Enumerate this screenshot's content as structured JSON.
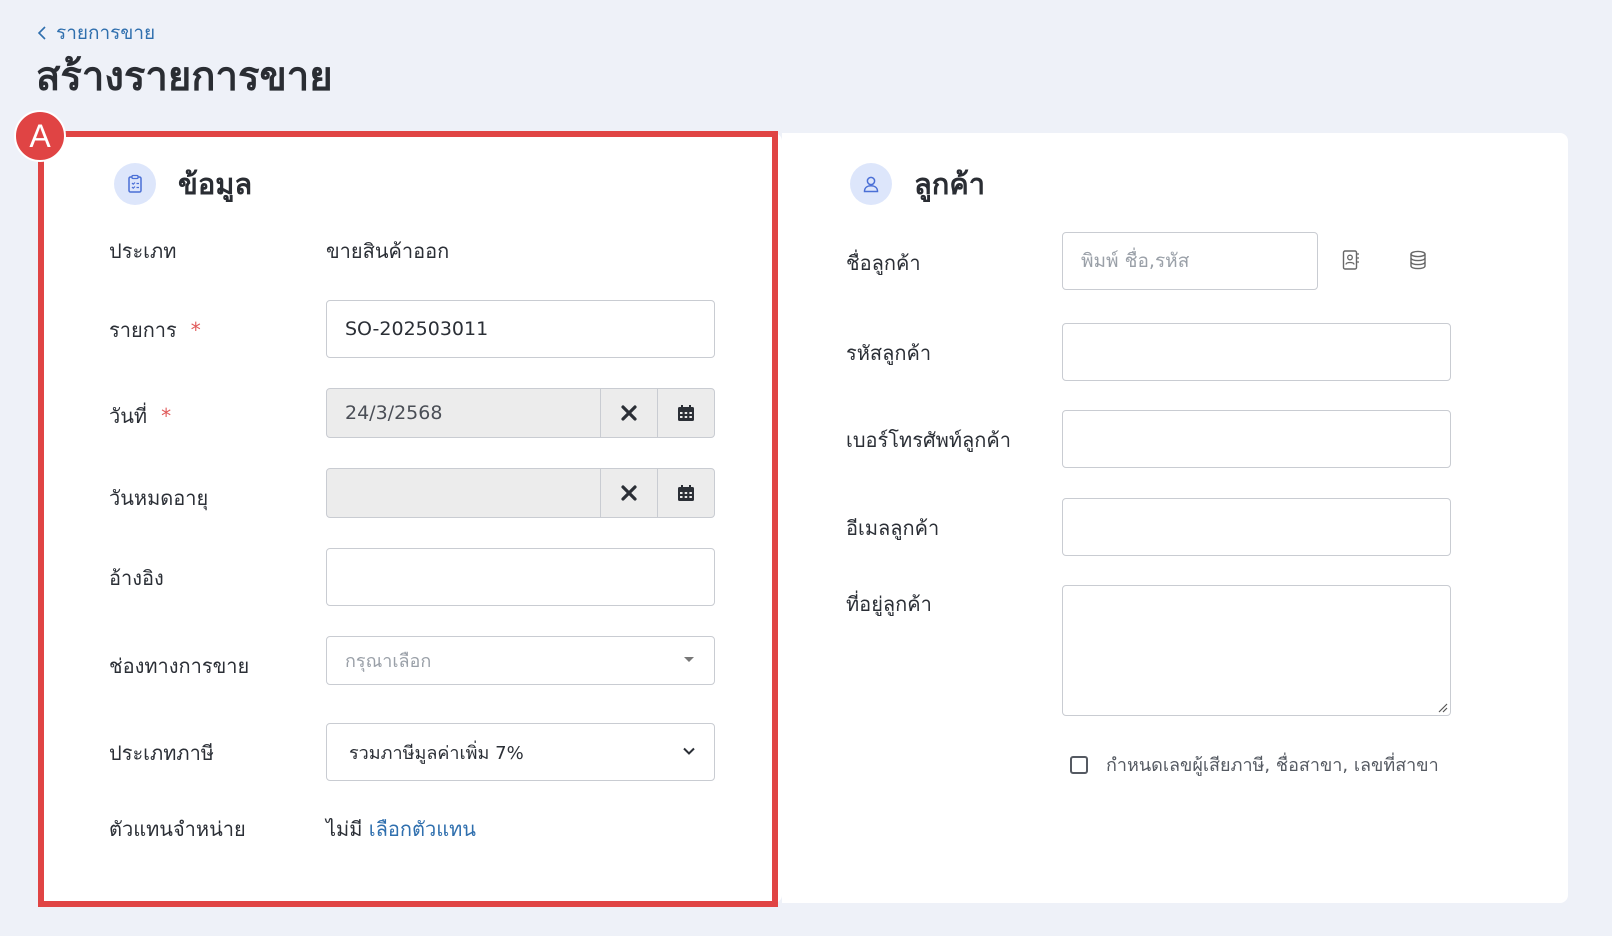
{
  "breadcrumb": {
    "back_label": "รายการขาย"
  },
  "page": {
    "title": "สร้างรายการขาย"
  },
  "annotation": {
    "marker": "A",
    "color": "#e04444"
  },
  "info": {
    "title": "ข้อมูล",
    "type_label": "ประเภท",
    "type_value": "ขายสินค้าออก",
    "doc_label": "รายการ",
    "doc_value": "SO-202503011",
    "date_label": "วันที่",
    "date_value": "24/3/2568",
    "expire_label": "วันหมดอายุ",
    "expire_value": "",
    "ref_label": "อ้างอิง",
    "ref_value": "",
    "channel_label": "ช่องทางการขาย",
    "channel_placeholder": "กรุณาเลือก",
    "tax_label": "ประเภทภาษี",
    "tax_value": "รวมภาษีมูลค่าเพิ่ม 7%",
    "agent_label": "ตัวแทนจำหน่าย",
    "agent_value": "ไม่มี",
    "agent_link": "เลือกตัวแทน",
    "required_mark": "*"
  },
  "customer": {
    "title": "ลูกค้า",
    "name_label": "ชื่อลูกค้า",
    "name_placeholder": "พิมพ์ ชื่อ,รหัส",
    "code_label": "รหัสลูกค้า",
    "phone_label": "เบอร์โทรศัพท์ลูกค้า",
    "email_label": "อีเมลลูกค้า",
    "address_label": "ที่อยู่ลูกค้า",
    "tax_checkbox_label": "กำหนดเลขผู้เสียภาษี, ชื่อสาขา, เลขที่สาขา"
  },
  "colors": {
    "accent": "#2f6fae",
    "required": "#e05a5a",
    "background": "#eef1f8"
  }
}
